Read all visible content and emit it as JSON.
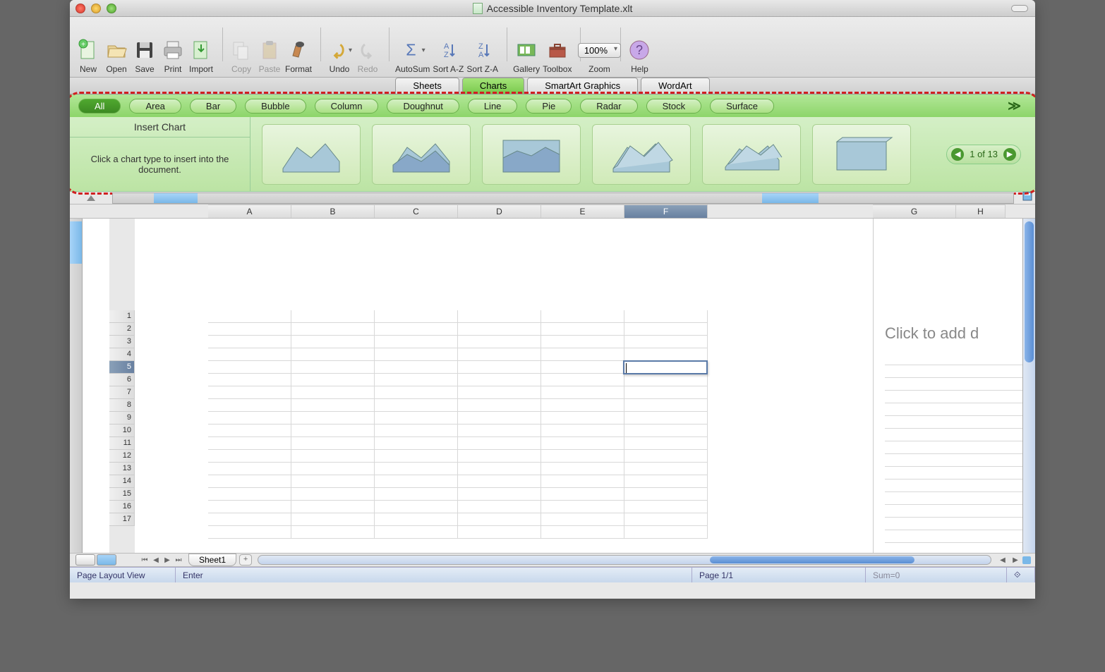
{
  "window": {
    "title": "Accessible Inventory Template.xlt"
  },
  "toolbar": {
    "new": "New",
    "open": "Open",
    "save": "Save",
    "print": "Print",
    "import": "Import",
    "copy": "Copy",
    "paste": "Paste",
    "format": "Format",
    "undo": "Undo",
    "redo": "Redo",
    "autosum": "AutoSum",
    "sortaz": "Sort A-Z",
    "sortza": "Sort Z-A",
    "gallery": "Gallery",
    "toolbox": "Toolbox",
    "zoom_label": "Zoom",
    "zoom_value": "100%",
    "help": "Help"
  },
  "ribbon_tabs": {
    "sheets": "Sheets",
    "charts": "Charts",
    "smartart": "SmartArt Graphics",
    "wordart": "WordArt",
    "active": "charts"
  },
  "chart_types": [
    "All",
    "Area",
    "Bar",
    "Bubble",
    "Column",
    "Doughnut",
    "Line",
    "Pie",
    "Radar",
    "Stock",
    "Surface"
  ],
  "chart_types_active": "All",
  "insert_panel": {
    "title": "Insert Chart",
    "desc": "Click a chart type to insert into the document."
  },
  "pager": {
    "text": "1 of 13"
  },
  "columns": [
    "A",
    "B",
    "C",
    "D",
    "E",
    "F",
    "G",
    "H"
  ],
  "selected_column": "F",
  "rows": [
    "1",
    "2",
    "3",
    "4",
    "5",
    "6",
    "7",
    "8",
    "9",
    "10",
    "11",
    "12",
    "13",
    "14",
    "15",
    "16",
    "17"
  ],
  "selected_row": "5",
  "sheet": {
    "name": "Sheet1"
  },
  "page2_hint": "Click to add d",
  "status": {
    "view": "Page Layout View",
    "mode": "Enter",
    "page": "Page 1/1",
    "sum": "Sum=0"
  }
}
